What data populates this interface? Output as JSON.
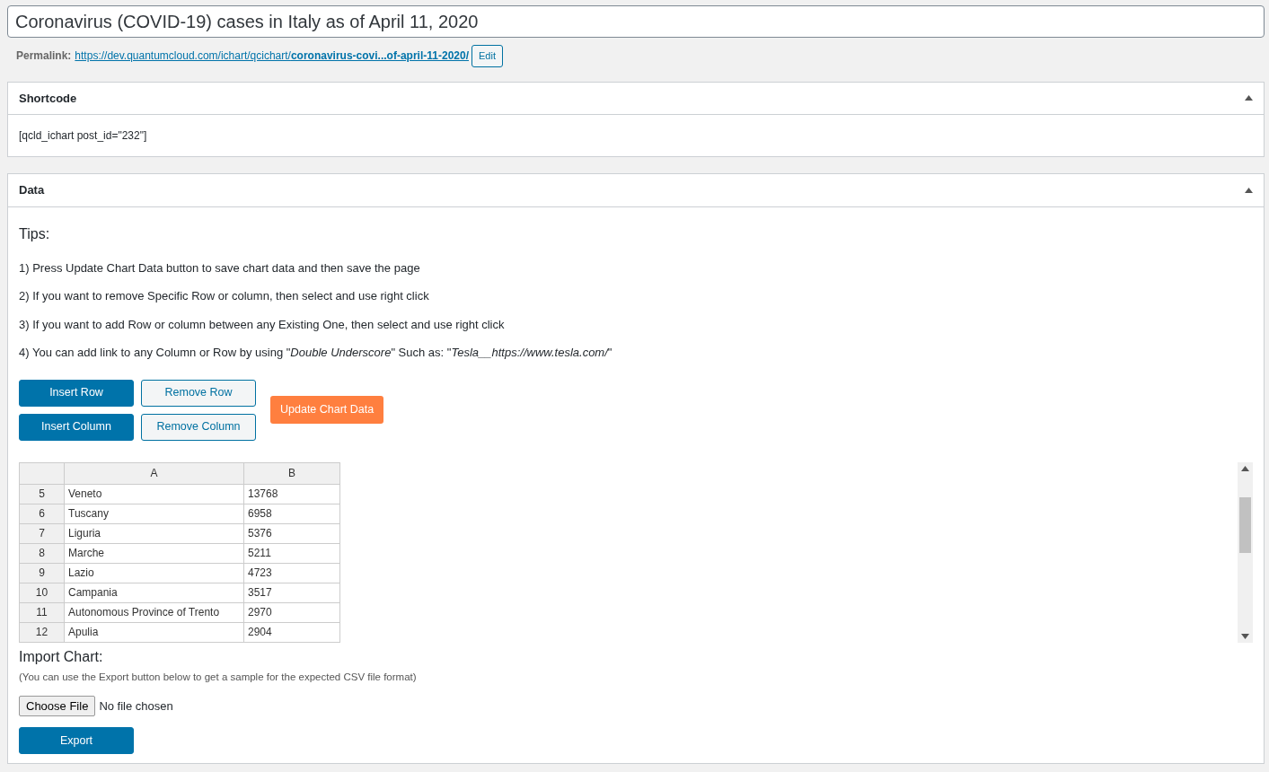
{
  "title_field": {
    "value": "Coronavirus (COVID-19) cases in Italy as of April 11, 2020"
  },
  "permalink": {
    "label": "Permalink:",
    "url": "https://dev.quantumcloud.com/ichart/qcichart/**coronavirus-covi...of-april-11-2020/**",
    "edit_button": "Edit"
  },
  "shortcode_panel": {
    "title": "Shortcode",
    "expanded": true,
    "content": "[qcld_ichart post_id=\"232\"]"
  },
  "data_panel": {
    "title": "Data",
    "expanded": true,
    "tips_heading": "Tips:",
    "tips": [
      "1) Press Update Chart Data button to save chart data and then save the page",
      "2) If you want to remove Specific Row or column, then select and use right click",
      "3) If you want to add Row or column between any Existing One, then select and use right click",
      "4) You can add link to any Column or Row by using \"*Double Underscore*\" Such as: \"*Tesla__https://www.tesla.com/*\""
    ],
    "buttons": [
      {
        "label": "Insert Row",
        "kind": "primary"
      },
      {
        "label": "Remove Row",
        "kind": "outline"
      },
      {
        "label": "Insert Column",
        "kind": "primary"
      },
      {
        "label": "Remove Column",
        "kind": "outline"
      }
    ],
    "update_button": "Update Chart Data",
    "sheet": {
      "columns": [
        "A",
        "B"
      ],
      "rows": [
        {
          "index": "5",
          "cells": [
            "Veneto",
            "13768"
          ]
        },
        {
          "index": "6",
          "cells": [
            "Tuscany",
            "6958"
          ]
        },
        {
          "index": "7",
          "cells": [
            "Liguria",
            "5376"
          ]
        },
        {
          "index": "8",
          "cells": [
            "Marche",
            "5211"
          ]
        },
        {
          "index": "9",
          "cells": [
            "Lazio",
            "4723"
          ]
        },
        {
          "index": "10",
          "cells": [
            "Campania",
            "3517"
          ]
        },
        {
          "index": "11",
          "cells": [
            "Autonomous Province of Trento",
            "2970"
          ]
        },
        {
          "index": "12",
          "cells": [
            "Apulia",
            "2904"
          ]
        }
      ]
    },
    "import_heading": "Import Chart:",
    "import_note": "(You can use the Export button below to get a sample for the expected CSV file format)",
    "file_input": {
      "button": "Choose File",
      "status": "No file chosen"
    },
    "export_button": "Export"
  }
}
